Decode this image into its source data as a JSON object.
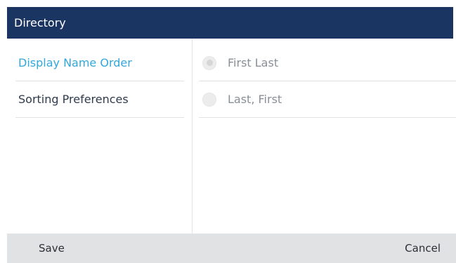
{
  "header": {
    "title": "Directory"
  },
  "menu": {
    "items": [
      {
        "label": "Display Name Order",
        "selected": true
      },
      {
        "label": "Sorting Preferences",
        "selected": false
      }
    ]
  },
  "options": [
    {
      "label": "First Last",
      "checked": true
    },
    {
      "label": "Last, First",
      "checked": false
    }
  ],
  "softkeys": {
    "save": "Save",
    "cancel": "Cancel"
  },
  "colors": {
    "header_bg": "#1b3563",
    "selected_text": "#33a7da",
    "softkey_bar": "#e1e2e4"
  }
}
